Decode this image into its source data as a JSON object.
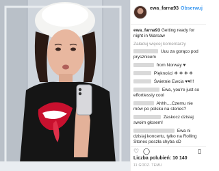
{
  "header": {
    "username": "ewa_farna93",
    "separator": "•",
    "follow_label": "Obserwuj"
  },
  "caption": {
    "username": "ewa_farna93",
    "text": "Getting ready for night in Warsaw"
  },
  "load_more_label": "Załaduj więcej komentarzy",
  "comments": [
    {
      "text": "Uuu za gorąco pod prysznicem"
    },
    {
      "text": "from Norway ♥"
    },
    {
      "text": "Piękności ❄ ❄ ❄ ❄"
    },
    {
      "text": "Świetnie Ewcia ♥♥!!!"
    },
    {
      "text": "Ewa, you're just so effortlessly cool"
    },
    {
      "text": "Ahhh....Czemu nie mów po polsku na stories?"
    },
    {
      "text": "Zaskocz dzisiaj swoim głosem!"
    },
    {
      "text": "Ewa ni dzisiaj koncertu, tylko na Rolling Stones poszła chyba xD"
    }
  ],
  "likes_text": "Liczba polubień: 10 140",
  "timestamp": "11 GODZ. TEMU",
  "icons": {
    "like": "heart-icon",
    "comment": "comment-icon",
    "save": "bookmark-icon"
  },
  "colors": {
    "accent": "#3897f0",
    "shirt_lips": "#c8102e"
  }
}
